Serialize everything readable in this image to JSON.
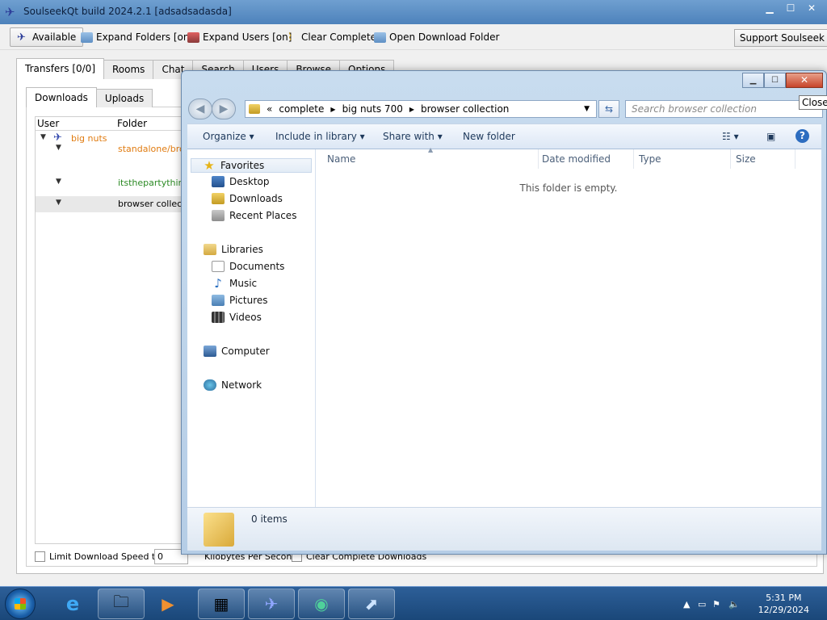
{
  "soulseek": {
    "title": "SoulseekQt build 2024.2.1 [adsadsadasda]",
    "toolbar": {
      "available": "Available",
      "expand_folders": "Expand Folders [on]",
      "expand_users": "Expand Users [on]",
      "clear_complete": "Clear Complete",
      "open_download_folder": "Open Download Folder",
      "support": "Support Soulseek"
    },
    "tabs": [
      "Transfers [0/0]",
      "Rooms",
      "Chat",
      "Search",
      "Users",
      "Browse",
      "Options"
    ],
    "subtabs": [
      "Downloads",
      "Uploads"
    ],
    "columns": {
      "user": "User",
      "folder": "Folder"
    },
    "rows": [
      {
        "user": "big nuts",
        "folder": ""
      },
      {
        "user": "",
        "folder": "standalone/brow"
      },
      {
        "user": "",
        "folder": "itsthepartything"
      },
      {
        "user": "",
        "folder": "browser collectio"
      }
    ],
    "bottom": {
      "limit_label": "Limit Download Speed to",
      "limit_value": "0",
      "kbps_label": "Kilobytes Per Second",
      "clear_label": "Clear Complete Downloads"
    }
  },
  "explorer": {
    "breadcrumb": [
      "«",
      "complete",
      "big nuts 700",
      "browser collection"
    ],
    "search_placeholder": "Search browser collection",
    "commands": {
      "organize": "Organize ▾",
      "include": "Include in library ▾",
      "share": "Share with ▾",
      "new_folder": "New folder"
    },
    "nav": {
      "favorites": "Favorites",
      "desktop": "Desktop",
      "downloads": "Downloads",
      "recent": "Recent Places",
      "libraries": "Libraries",
      "documents": "Documents",
      "music": "Music",
      "pictures": "Pictures",
      "videos": "Videos",
      "computer": "Computer",
      "network": "Network"
    },
    "columns": {
      "name": "Name",
      "date": "Date modified",
      "type": "Type",
      "size": "Size"
    },
    "empty_message": "This folder is empty.",
    "item_count": "0 items",
    "close_tooltip": "Close"
  },
  "taskbar": {
    "time": "5:31 PM",
    "date": "12/29/2024"
  }
}
